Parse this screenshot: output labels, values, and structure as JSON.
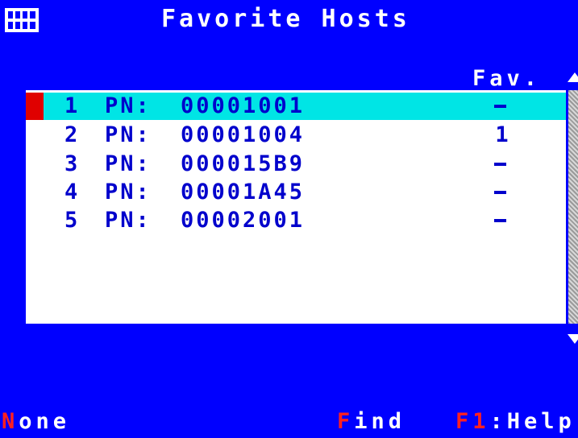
{
  "window": {
    "title": "Favorite Hosts",
    "icon": "grid-icon"
  },
  "list": {
    "column_header": "Fav.",
    "pn_label": "PN:",
    "rows": [
      {
        "num": "1",
        "id": "00001001",
        "fav": "-",
        "selected": true
      },
      {
        "num": "2",
        "id": "00001004",
        "fav": "1",
        "selected": false
      },
      {
        "num": "3",
        "id": "000015B9",
        "fav": "-",
        "selected": false
      },
      {
        "num": "4",
        "id": "00001A45",
        "fav": "-",
        "selected": false
      },
      {
        "num": "5",
        "id": "00002001",
        "fav": "-",
        "selected": false
      }
    ]
  },
  "footer": {
    "none": {
      "key": "N",
      "rest": "one"
    },
    "find": {
      "key": "F",
      "rest": "ind"
    },
    "help": {
      "key": "F1",
      "rest": ":Help"
    }
  },
  "colors": {
    "background": "#0000ff",
    "selected_row": "#00e5e5",
    "selection_marker": "#e00000",
    "hotkey": "#ff2020",
    "list_text": "#0000cc"
  }
}
